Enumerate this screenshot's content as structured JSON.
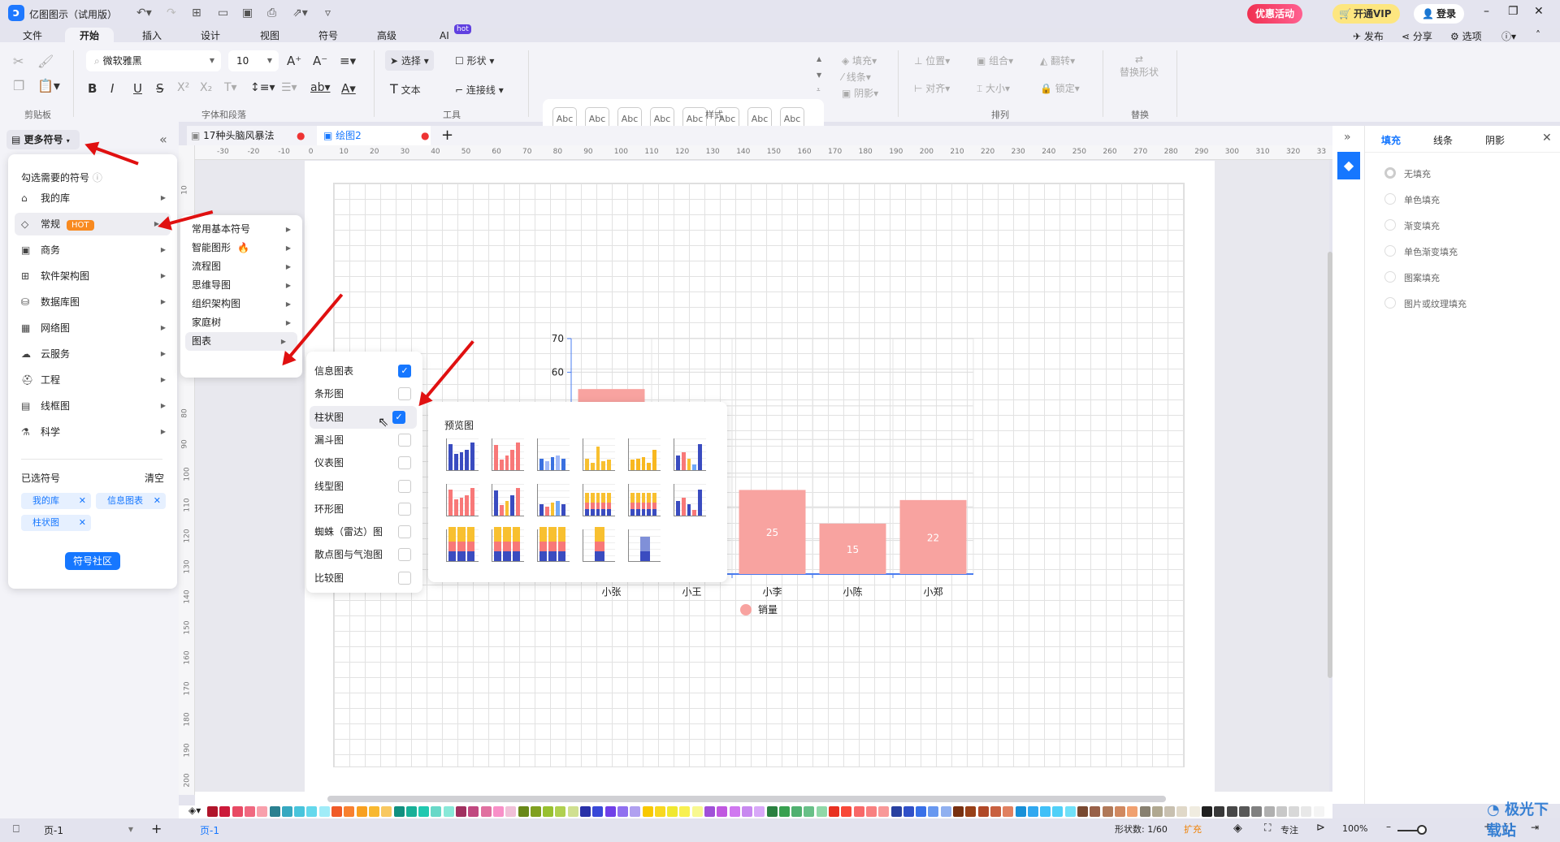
{
  "app": {
    "title": "亿图图示（试用版）",
    "promo": "优惠活动",
    "vip": "开通VIP",
    "login": "登录"
  },
  "menu_tabs": [
    "文件",
    "开始",
    "插入",
    "设计",
    "视图",
    "符号",
    "高级",
    "AI"
  ],
  "ai_badge": "hot",
  "top_right": {
    "publish": "发布",
    "share": "分享",
    "options": "选项"
  },
  "ribbon": {
    "font": "微软雅黑",
    "size": "10",
    "select": "选择",
    "shape": "形状",
    "text": "文本",
    "connector": "连接线",
    "style_sample": "Abc",
    "fill": "填充",
    "line": "线条",
    "shadow": "阴影",
    "position": "位置",
    "group": "组合",
    "flip": "翻转",
    "align": "对齐",
    "size_btn": "大小",
    "lock": "锁定",
    "replace_shape": "替换形状",
    "groups": [
      "剪贴板",
      "字体和段落",
      "工具",
      "样式",
      "排列",
      "替换"
    ]
  },
  "doc_tabs": [
    {
      "label": "17种头脑风暴法"
    },
    {
      "label": "绘图2",
      "active": true
    }
  ],
  "ruler_h": [
    "-30",
    "-20",
    "-10",
    "0",
    "10",
    "20",
    "30",
    "40",
    "50",
    "60",
    "70",
    "80",
    "90",
    "100",
    "110",
    "120",
    "130",
    "140",
    "150",
    "160",
    "170",
    "180",
    "190",
    "200",
    "210",
    "220",
    "230",
    "240",
    "250",
    "260",
    "270",
    "280",
    "290",
    "300",
    "310",
    "320",
    "33"
  ],
  "ruler_v": [
    "10",
    "80",
    "90",
    "100",
    "110",
    "120",
    "130",
    "140",
    "150",
    "160",
    "170",
    "180",
    "190",
    "200"
  ],
  "left_panel": {
    "header": "更多符号",
    "hint": "勾选需要的符号",
    "categories": [
      {
        "label": "我的库"
      },
      {
        "label": "常规",
        "badge": "HOT"
      },
      {
        "label": "商务"
      },
      {
        "label": "软件架构图"
      },
      {
        "label": "数据库图"
      },
      {
        "label": "网络图"
      },
      {
        "label": "云服务"
      },
      {
        "label": "工程"
      },
      {
        "label": "线框图"
      },
      {
        "label": "科学"
      }
    ],
    "selected_title": "已选符号",
    "clear": "清空",
    "selected": [
      "我的库",
      "信息图表",
      "柱状图"
    ],
    "community": "符号社区"
  },
  "submenu1": [
    "常用基本符号",
    "智能图形",
    "流程图",
    "思维导图",
    "组织架构图",
    "家庭树",
    "图表"
  ],
  "submenu2": [
    {
      "label": "信息图表",
      "checked": true
    },
    {
      "label": "条形图",
      "checked": false
    },
    {
      "label": "柱状图",
      "checked": true
    },
    {
      "label": "漏斗图",
      "checked": false
    },
    {
      "label": "仪表图",
      "checked": false
    },
    {
      "label": "线型图",
      "checked": false
    },
    {
      "label": "环形图",
      "checked": false
    },
    {
      "label": "蜘蛛（雷达）图",
      "checked": false
    },
    {
      "label": "散点图与气泡图",
      "checked": false
    },
    {
      "label": "比较图",
      "checked": false
    }
  ],
  "preview": {
    "title": "预览图",
    "count": 17
  },
  "chart_data": {
    "type": "bar",
    "categories": [
      "小张",
      "小王",
      "小李",
      "小陈",
      "小郑"
    ],
    "values": [
      55,
      null,
      25,
      15,
      22
    ],
    "data_labels": [
      "",
      "",
      "25",
      "15",
      "22"
    ],
    "yticks": [
      "70",
      "60"
    ],
    "ylim": [
      0,
      70
    ],
    "legend": "销量",
    "legend_position": "bottom",
    "color": "#f8a3a0",
    "grid": true
  },
  "right_panel": {
    "tabs": [
      "填充",
      "线条",
      "阴影"
    ],
    "options": [
      "无填充",
      "单色填充",
      "渐变填充",
      "单色渐变填充",
      "图案填充",
      "图片或纹理填充"
    ]
  },
  "status": {
    "page_select": "页-1",
    "page_tab": "页-1",
    "shape_count": "形状数: 1/60",
    "expand": "扩充",
    "focus": "专注",
    "zoom": "100%"
  },
  "watermark": "极光下载站",
  "palette": [
    "#b0142a",
    "#cc1a3a",
    "#e84a64",
    "#f06880",
    "#f8a0ac",
    "#2a8090",
    "#36a8c0",
    "#48c4dc",
    "#64d8ec",
    "#a0ecf8",
    "#f05a28",
    "#f88030",
    "#f8a020",
    "#f8b830",
    "#f8c860",
    "#109080",
    "#18b098",
    "#20c8b0",
    "#68d8c8",
    "#88e8d8",
    "#a03060",
    "#c04880",
    "#e070a0",
    "#f890c8",
    "#f0c0d8",
    "#688818",
    "#80a020",
    "#98c030",
    "#b0d050",
    "#d0e090",
    "#2830a8",
    "#3848d8",
    "#7040e8",
    "#9070f0",
    "#b0a0f0",
    "#f8c800",
    "#f8d820",
    "#f0e830",
    "#f8f050",
    "#f8f890",
    "#a050d8",
    "#c058e0",
    "#d078f0",
    "#c888f0",
    "#d8a8f8",
    "#2a8040",
    "#38a050",
    "#50b070",
    "#68c088",
    "#90d8a8",
    "#e83020",
    "#f84838",
    "#f86868",
    "#f88080",
    "#f89898",
    "#2840a0",
    "#3050c8",
    "#3870e8",
    "#6898f0",
    "#90b0f0",
    "#783010",
    "#984018",
    "#b04828",
    "#c86040",
    "#e08060",
    "#1890d8",
    "#30a8f0",
    "#40c0f8",
    "#50d0f8",
    "#70e0f8",
    "#784830",
    "#986048",
    "#b07858",
    "#d08860",
    "#f0a070",
    "#888070",
    "#b0a890",
    "#c8c0b0",
    "#e0d8c8",
    "#f0ece0",
    "#202020",
    "#383838",
    "#484848",
    "#585858",
    "#808080",
    "#b0b0b0",
    "#c8c8c8",
    "#d8d8d8",
    "#e8e8e8",
    "#f4f4f4"
  ]
}
